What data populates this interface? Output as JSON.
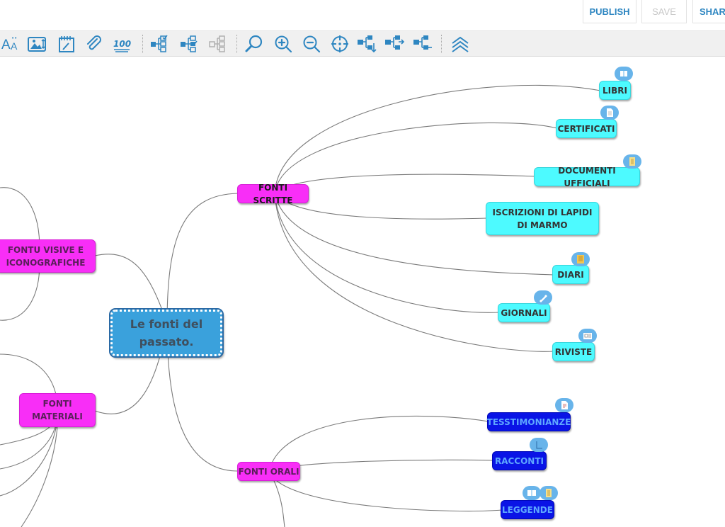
{
  "topbar": {
    "publish": "PUBLISH",
    "save": "SAVE",
    "share": "SHAR"
  },
  "toolbar": {
    "icons": [
      "font-size-icon",
      "image-icon",
      "calendar-note-icon",
      "attachment-icon",
      "score-100-icon",
      "select-children-icon",
      "select-siblings-icon",
      "select-disabled-icon",
      "search-icon",
      "zoom-in-icon",
      "zoom-out-icon",
      "center-target-icon",
      "expand-tree-icon",
      "collapse-tree-icon",
      "layout-tree-icon",
      "collapse-all-icon"
    ]
  },
  "colors": {
    "accent": "#2e86c1",
    "root": "#3aa1dc",
    "category": "#f82ef7",
    "leaf_cyan": "#4dfaff",
    "leaf_blue": "#0a14e6"
  },
  "mindmap": {
    "root": "Le fonti del passato.",
    "fonti_scritte": "FONTI SCRITTE",
    "fonti_orali": "FONTI ORALI",
    "fonti_visive": "FONTU VISIVE E ICONOGRAFICHE",
    "fonti_materiali": "FONTI MATERIALI",
    "scritte_children": [
      "LIBRI",
      "CERTIFICATI",
      "DOCUMENTI UFFICIALI",
      "ISCRIZIONI DI LAPIDI DI MARMO",
      "DIARI",
      "GIORNALI",
      "RIVISTE"
    ],
    "orali_children": [
      "TESSTIMONIANZE",
      "RACCONTI",
      "LEGGENDE"
    ]
  }
}
